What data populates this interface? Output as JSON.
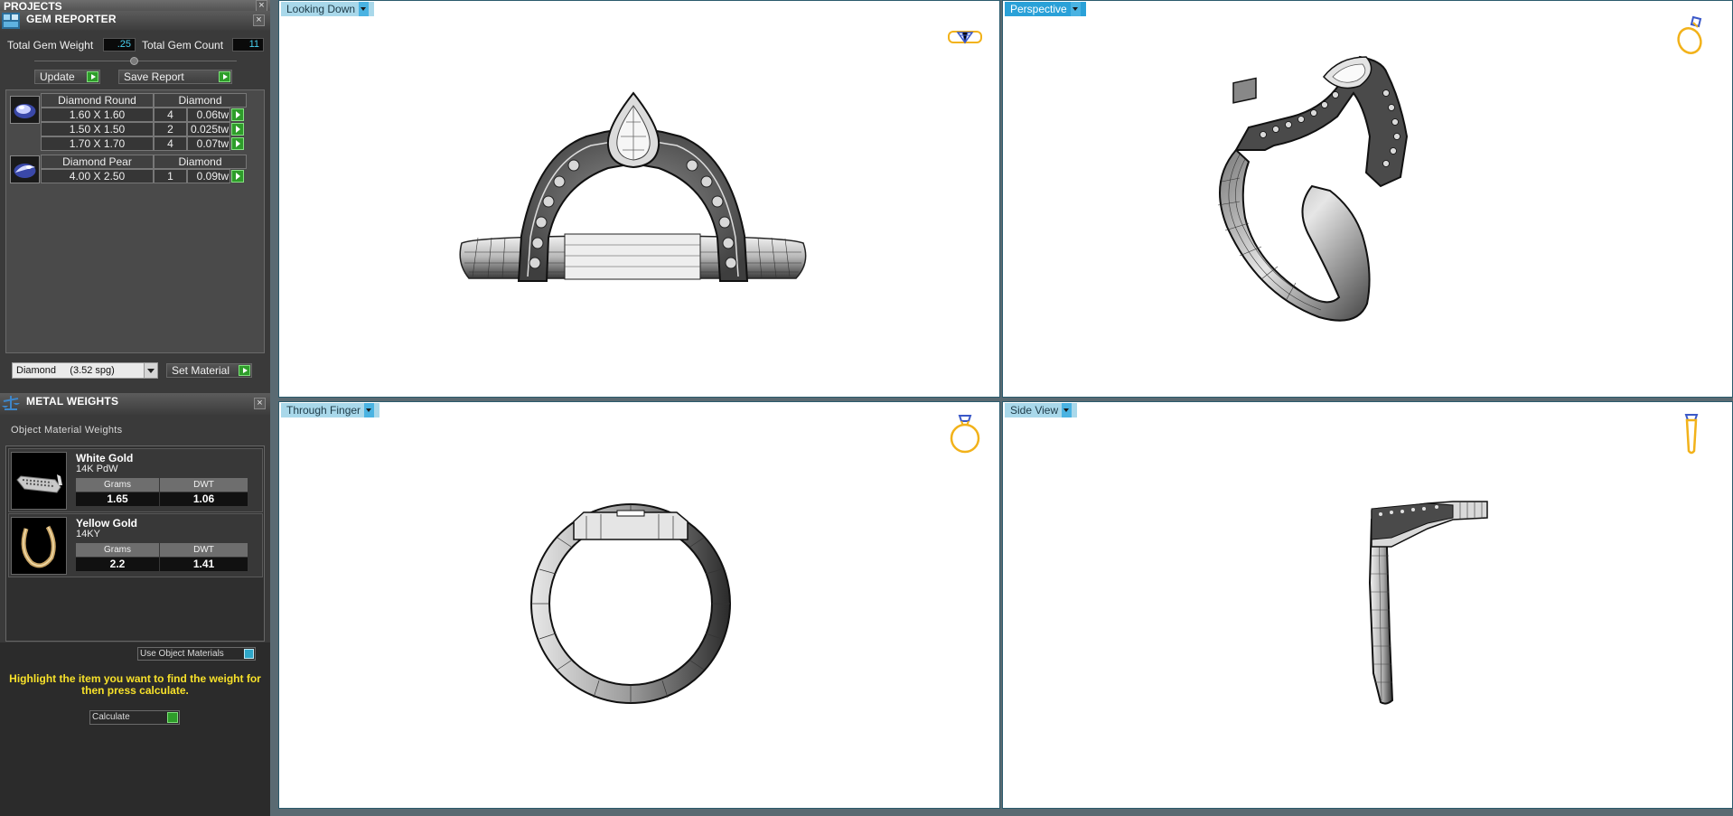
{
  "projects": {
    "title": "PROJECTS"
  },
  "gem_reporter": {
    "title": "GEM REPORTER",
    "total_weight_label": "Total Gem Weight",
    "total_weight_value": ".25",
    "total_count_label": "Total Gem Count",
    "total_count_value": "11",
    "update_label": "Update",
    "save_report_label": "Save Report",
    "groups": [
      {
        "shape": "Diamond Round",
        "material": "Diamond",
        "rows": [
          {
            "size": "1.60 X 1.60",
            "count": "4",
            "weight": "0.06tw"
          },
          {
            "size": "1.50 X 1.50",
            "count": "2",
            "weight": "0.025tw"
          },
          {
            "size": "1.70 X 1.70",
            "count": "4",
            "weight": "0.07tw"
          }
        ]
      },
      {
        "shape": "Diamond Pear",
        "material": "Diamond",
        "rows": [
          {
            "size": "4.00 X 2.50",
            "count": "1",
            "weight": "0.09tw"
          }
        ]
      }
    ],
    "material_select": "Diamond     (3.52 spg)",
    "set_material_label": "Set Material"
  },
  "metal_weights": {
    "title": "METAL WEIGHTS",
    "section_label": "Object Material Weights",
    "items": [
      {
        "name": "White Gold",
        "alloy": "14K PdW",
        "grams_label": "Grams",
        "dwt_label": "DWT",
        "grams": "1.65",
        "dwt": "1.06"
      },
      {
        "name": "Yellow Gold",
        "alloy": "14KY",
        "grams_label": "Grams",
        "dwt_label": "DWT",
        "grams": "2.2",
        "dwt": "1.41"
      }
    ],
    "use_object_materials": "Use Object Materials",
    "hint": "Highlight the item you want to find the weight for then press calculate.",
    "calculate_label": "Calculate"
  },
  "viewports": [
    {
      "label": "Looking Down",
      "active": false,
      "icon": "ring-top-icon"
    },
    {
      "label": "Perspective",
      "active": true,
      "icon": "ring-perspective-icon"
    },
    {
      "label": "Through Finger",
      "active": false,
      "icon": "ring-front-icon"
    },
    {
      "label": "Side View",
      "active": false,
      "icon": "ring-side-icon"
    }
  ],
  "colors": {
    "accent_blue": "#2aa1d8",
    "readout": "#48d0f0",
    "hint_yellow": "#f7e12a",
    "go_green": "#2e9d2a",
    "icon_gold": "#f2b21a"
  }
}
